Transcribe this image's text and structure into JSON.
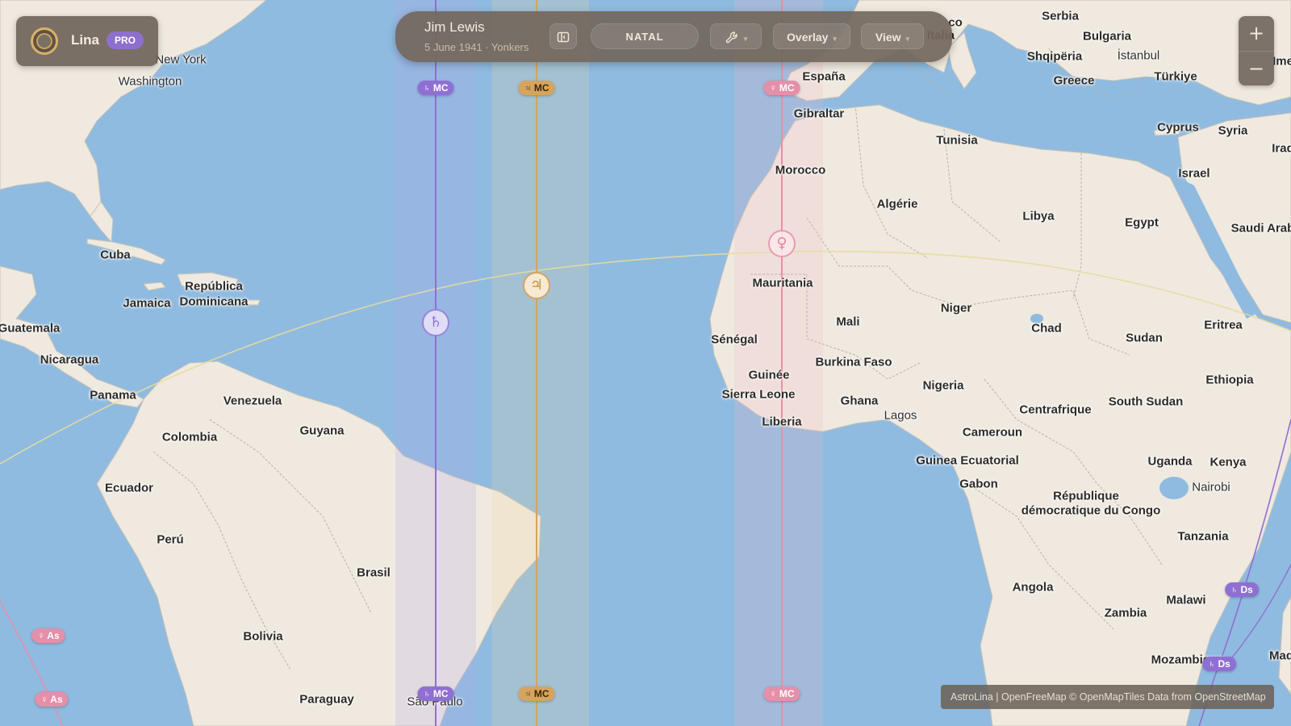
{
  "app": {
    "brand_name": "Lina",
    "plan_badge": "PRO"
  },
  "toolbar": {
    "person_name": "Jim Lewis",
    "person_details": "5 June 1941 · Yonkers",
    "chart_mode": "NATAL",
    "overlay_label": "Overlay",
    "view_label": "View",
    "tools_icon": "wrench-icon",
    "sidebar_icon": "sidebar-toggle-icon"
  },
  "zoom": {
    "in_label": "+",
    "out_label": "−"
  },
  "attribution": "AstroLina | OpenFreeMap © OpenMapTiles Data from OpenStreetMap",
  "colors": {
    "saturn": "#8f6fd3",
    "jupiter": "#d6a45e",
    "venus": "#e68fa8",
    "ocean": "#8fbbe0",
    "land": "#efe9df",
    "ecliptic": "#e8dc9a"
  },
  "planet_lines": [
    {
      "planet": "Saturn",
      "glyph": "♄",
      "angle": "MC",
      "label": "♄ MC"
    },
    {
      "planet": "Jupiter",
      "glyph": "♃",
      "angle": "MC",
      "label": "♃ MC"
    },
    {
      "planet": "Venus",
      "glyph": "♀",
      "angle": "MC",
      "label": "♀ MC"
    },
    {
      "planet": "Venus",
      "glyph": "♀",
      "angle": "As",
      "label": "♀ As"
    },
    {
      "planet": "Saturn",
      "glyph": "♄",
      "angle": "Ds",
      "label": "♄ Ds"
    }
  ],
  "planet_markers": {
    "saturn": "♄",
    "jupiter": "♃",
    "venus": "♀"
  },
  "place_labels": {
    "countries": [
      "Cuba",
      "República",
      "Dominicana",
      "Jamaica",
      "Guatemala",
      "Nicaragua",
      "Panama",
      "Venezuela",
      "Colombia",
      "Guyana",
      "Ecuador",
      "Perú",
      "Brasil",
      "Bolivia",
      "Paraguay",
      "España",
      "Italia",
      "Serbia",
      "Bulgaria",
      "Shqipëria",
      "Greece",
      "Türkiye",
      "Cyprus",
      "Syria",
      "Iraq",
      "Israel",
      "Egypt",
      "Saudi Arab",
      "Gibraltar",
      "Morocco",
      "Tunisia",
      "Algérie",
      "Libya",
      "Mauritania",
      "Mali",
      "Niger",
      "Chad",
      "Sudan",
      "Eritrea",
      "Sénégal",
      "Burkina Faso",
      "Guinée",
      "Sierra Leone",
      "Liberia",
      "Ghana",
      "Nigeria",
      "Centrafrique",
      "South Sudan",
      "Ethiopia",
      "Cameroun",
      "Guinea Ecuatorial",
      "Gabon",
      "Uganda",
      "Kenya",
      "République",
      "démocratique du Congo",
      "Tanzania",
      "Angola",
      "Zambia",
      "Malawi",
      "Mozambique",
      "Mad",
      "Ime",
      "co"
    ],
    "cities": [
      "New York",
      "Washington",
      "Lagos",
      "Nairobi",
      "İstanbul",
      "São Paulo"
    ]
  }
}
